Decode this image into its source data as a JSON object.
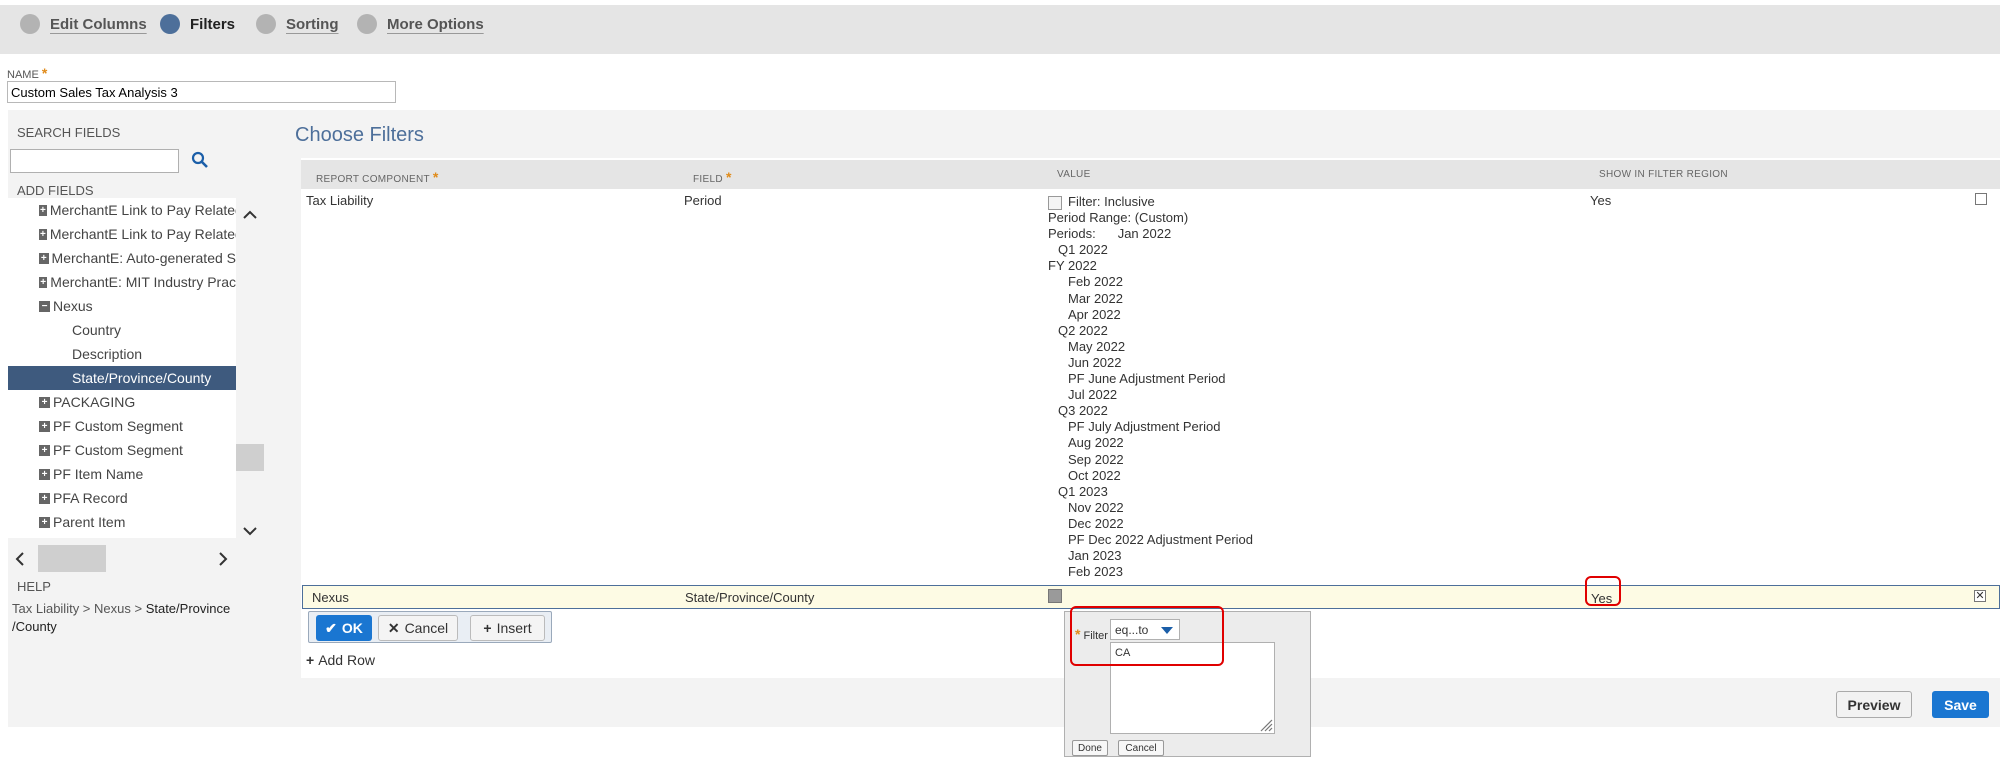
{
  "steps": [
    {
      "label": "Edit Columns"
    },
    {
      "label": "Filters"
    },
    {
      "label": "Sorting"
    },
    {
      "label": "More Options"
    }
  ],
  "name_field": {
    "label": "NAME",
    "required_mark": "*",
    "value": "Custom Sales Tax Analysis 3"
  },
  "left_panel": {
    "search_fields_label": "SEARCH FIELDS",
    "search_value": "",
    "add_fields_label": "ADD FIELDS",
    "tree_items": [
      {
        "label": "MerchantE Link to Pay Related",
        "toggle": "+"
      },
      {
        "label": "MerchantE Link to Pay Related",
        "toggle": "+"
      },
      {
        "label": "MerchantE: Auto-generated S",
        "toggle": "+"
      },
      {
        "label": "MerchantE: MIT Industry Prac",
        "toggle": "+"
      },
      {
        "label": "Nexus",
        "toggle": "−"
      },
      {
        "label": "Country",
        "toggle": ""
      },
      {
        "label": "Description",
        "toggle": ""
      },
      {
        "label": "State/Province/County",
        "toggle": ""
      },
      {
        "label": "PACKAGING",
        "toggle": "+"
      },
      {
        "label": "PF Custom Segment",
        "toggle": "+"
      },
      {
        "label": "PF Custom Segment",
        "toggle": "+"
      },
      {
        "label": "PF Item Name",
        "toggle": "+"
      },
      {
        "label": "PFA Record",
        "toggle": "+"
      },
      {
        "label": "Parent Item",
        "toggle": "+"
      }
    ],
    "help_label": "HELP",
    "help_path": "Tax Liability > Nexus > ",
    "help_current": "State/Province /County"
  },
  "main": {
    "title": "Choose Filters",
    "headers": {
      "report_component": "REPORT COMPONENT",
      "field": "FIELD",
      "value": "VALUE",
      "show_in_filter_region": "SHOW IN FILTER REGION",
      "required_mark": "*"
    },
    "row1": {
      "component": "Tax Liability",
      "field": "Period",
      "filter_text": "Filter: Inclusive",
      "range_text": "Period Range: (Custom)",
      "periods_label": "Periods:",
      "periods": [
        {
          "text": "Jan 2022",
          "level": 0
        },
        {
          "text": "Q1 2022",
          "level": 1
        },
        {
          "text": "FY 2022",
          "level": -1
        },
        {
          "text": "Feb 2022",
          "level": 2
        },
        {
          "text": "Mar 2022",
          "level": 2
        },
        {
          "text": "Apr 2022",
          "level": 2
        },
        {
          "text": "Q2 2022",
          "level": 1
        },
        {
          "text": "May 2022",
          "level": 2
        },
        {
          "text": "Jun 2022",
          "level": 2
        },
        {
          "text": "PF June Adjustment Period",
          "level": 2
        },
        {
          "text": "Jul 2022",
          "level": 2
        },
        {
          "text": "Q3 2022",
          "level": 1
        },
        {
          "text": "PF July Adjustment Period",
          "level": 2
        },
        {
          "text": "Aug 2022",
          "level": 2
        },
        {
          "text": "Sep 2022",
          "level": 2
        },
        {
          "text": "Oct 2022",
          "level": 2
        },
        {
          "text": "Q1 2023",
          "level": 1
        },
        {
          "text": "Nov 2022",
          "level": 2
        },
        {
          "text": "Dec 2022",
          "level": 2
        },
        {
          "text": "PF Dec 2022 Adjustment Period",
          "level": 2
        },
        {
          "text": "Jan 2023",
          "level": 2
        },
        {
          "text": "Feb 2023",
          "level": 2
        }
      ],
      "show": "Yes"
    },
    "row2": {
      "component": "Nexus",
      "field": "State/Province/County",
      "show": "Yes"
    },
    "buttons": {
      "ok": "OK",
      "cancel": "Cancel",
      "insert": "Insert",
      "add_row": "Add Row"
    },
    "popup": {
      "filter_label": "Filter",
      "required_mark": "*",
      "operator": "eq...to",
      "value": "CA",
      "done": "Done",
      "cancel": "Cancel"
    },
    "footer": {
      "preview": "Preview",
      "save": "Save"
    }
  }
}
